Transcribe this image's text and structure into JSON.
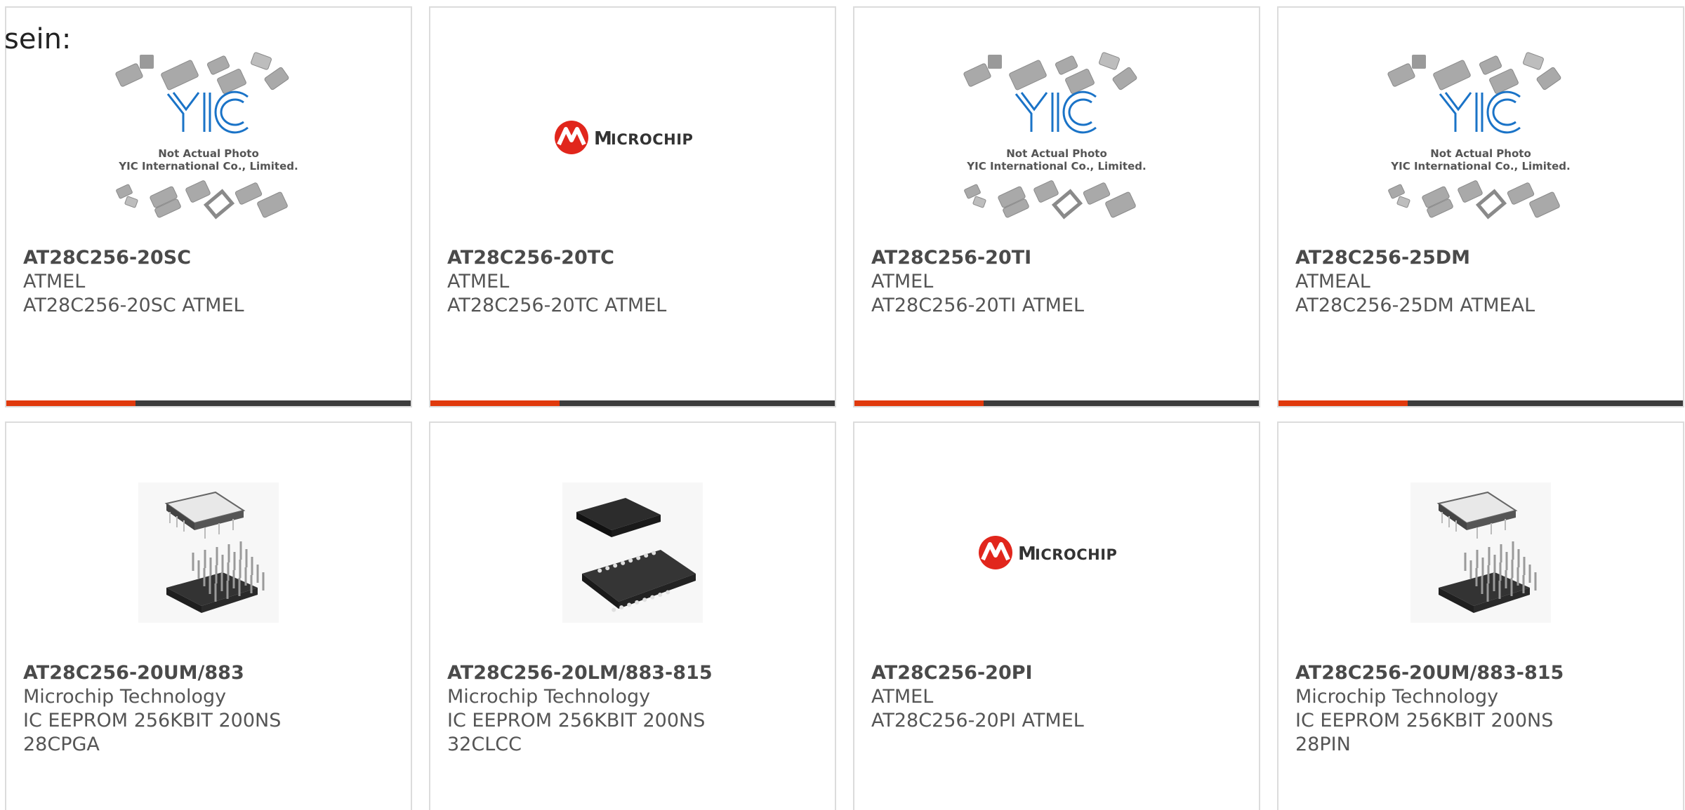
{
  "intro_text": "sein:",
  "colors": {
    "accent": "#e0390c",
    "bar_track": "#3c3c3c",
    "card_border": "#dcdcdc",
    "microchip_red": "#e1261c"
  },
  "placeholder_caption": {
    "line1": "Not Actual Photo",
    "line2": "YIC International Co., Limited."
  },
  "products": [
    {
      "part": "AT28C256-20SC",
      "brand": "ATMEL",
      "desc": [
        "AT28C256-20SC ATMEL"
      ],
      "image": "yic-placeholder-image",
      "progress": 0.32
    },
    {
      "part": "AT28C256-20TC",
      "brand": "ATMEL",
      "desc": [
        "AT28C256-20TC ATMEL"
      ],
      "image": "microchip-logo",
      "progress": 0.32
    },
    {
      "part": "AT28C256-20TI",
      "brand": "ATMEL",
      "desc": [
        "AT28C256-20TI ATMEL"
      ],
      "image": "yic-placeholder-image",
      "progress": 0.32
    },
    {
      "part": "AT28C256-25DM",
      "brand": "ATMEAL",
      "desc": [
        "AT28C256-25DM ATMEAL"
      ],
      "image": "yic-placeholder-image",
      "progress": 0.32
    },
    {
      "part": "AT28C256-20UM/883",
      "brand": "Microchip Technology",
      "desc": [
        "IC EEPROM 256KBIT 200NS",
        "28CPGA"
      ],
      "image": "pga-chip-photo"
    },
    {
      "part": "AT28C256-20LM/883-815",
      "brand": "Microchip Technology",
      "desc": [
        "IC EEPROM 256KBIT 200NS",
        "32CLCC"
      ],
      "image": "clcc-chip-photo"
    },
    {
      "part": "AT28C256-20PI",
      "brand": "ATMEL",
      "desc": [
        "AT28C256-20PI ATMEL"
      ],
      "image": "microchip-logo"
    },
    {
      "part": "AT28C256-20UM/883-815",
      "brand": "Microchip Technology",
      "desc": [
        "IC EEPROM 256KBIT 200NS",
        "28PIN"
      ],
      "image": "pga-chip-photo"
    }
  ]
}
